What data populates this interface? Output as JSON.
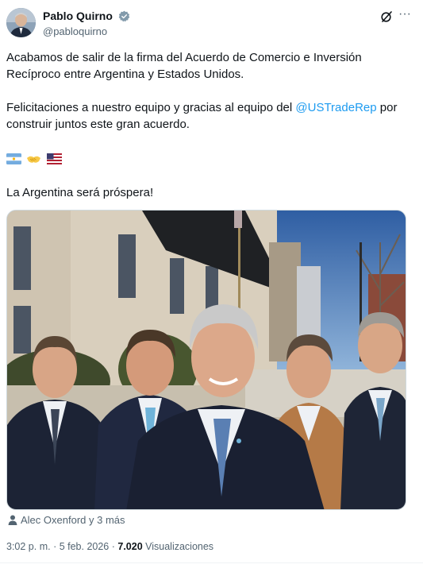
{
  "author": {
    "display_name": "Pablo Quirno",
    "handle": "@pabloquirno",
    "verified": true
  },
  "tweet": {
    "paragraph1": "Acabamos de salir de la firma del Acuerdo de Comercio e Inversión Recíproco entre Argentina y Estados Unidos.",
    "paragraph2_before": "Felicitaciones a nuestro equipo y gracias al equipo del ",
    "mention": "@USTradeRep",
    "paragraph2_after": " por construir juntos este gran acuerdo.",
    "emojis": [
      "argentina-flag",
      "handshake",
      "us-flag"
    ],
    "closing": "La Argentina será próspera!"
  },
  "media": {
    "tagged_text": "Alec Oxenford y 3 más"
  },
  "meta": {
    "time": "3:02 p. m.",
    "separator1": " · ",
    "date": "5 feb. 2026",
    "separator2": " · ",
    "views_count": "7.020",
    "views_label": " Visualizaciones"
  },
  "colors": {
    "accent": "#1d9bf0",
    "text": "#0f1419",
    "secondary": "#536471"
  }
}
